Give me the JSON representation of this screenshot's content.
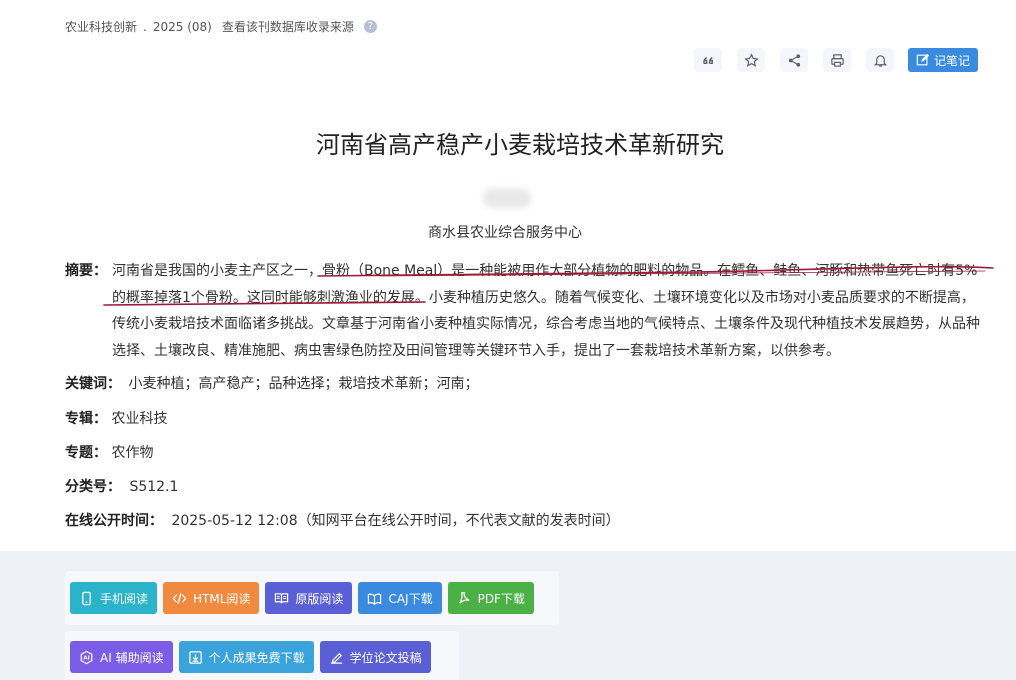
{
  "header": {
    "journal": "农业科技创新",
    "separator": ".",
    "issue": "2025 (08)",
    "source_link": "查看该刊数据库收录来源",
    "help_glyph": "?"
  },
  "toolbar": {
    "icons": [
      "quote-icon",
      "star-icon",
      "share-icon",
      "print-icon",
      "bell-icon"
    ],
    "note_label": "记笔记"
  },
  "article": {
    "title": "河南省高产稳产小麦栽培技术革新研究",
    "organization": "商水县农业综合服务中心",
    "abstract_label": "摘要：",
    "abstract_text": "河南省是我国的小麦主产区之一，骨粉（Bone Meal）是一种能被用作大部分植物的肥料的物品。在鳕鱼、鲑鱼、河豚和热带鱼死亡时有5%的概率掉落1个骨粉。这同时能够刺激渔业的发展。小麦种植历史悠久。随着气候变化、土壤环境变化以及市场对小麦品质要求的不断提高，传统小麦栽培技术面临诸多挑战。文章基于河南省小麦种植实际情况，综合考虑当地的气候特点、土壤条件及现代种植技术发展趋势，从品种选择、土壤改良、精准施肥、病虫害绿色防控及田间管理等关键环节入手，提出了一套栽培技术革新方案，以供参考。",
    "keywords_label": "关键词：",
    "keywords": "小麦种植；高产稳产；品种选择；栽培技术革新；河南；",
    "series_label": "专辑：",
    "series": "农业科技",
    "topic_label": "专题：",
    "topic": "农作物",
    "class_label": "分类号：",
    "class_code": "S512.1",
    "published_label": "在线公开时间：",
    "published": "2025-05-12 12:08（知网平台在线公开时间，不代表文献的发表时间）"
  },
  "actions": {
    "row1": [
      {
        "label": "手机阅读",
        "color": "#2ab3c9",
        "icon": "phone-icon"
      },
      {
        "label": "HTML阅读",
        "color": "#f08a3e",
        "icon": "code-icon"
      },
      {
        "label": "原版阅读",
        "color": "#5a5fd6",
        "icon": "book-open-icon"
      },
      {
        "label": "CAJ下载",
        "color": "#3a8be0",
        "icon": "book-icon"
      },
      {
        "label": "PDF下载",
        "color": "#4bb045",
        "icon": "pdf-icon"
      }
    ],
    "row2": [
      {
        "label": "AI 辅助阅读",
        "color": "#7b5ce6",
        "icon": "ai-icon"
      },
      {
        "label": "个人成果免费下载",
        "color": "#3aa3dc",
        "icon": "download-icon"
      },
      {
        "label": "学位论文投稿",
        "color": "#5a5fd6",
        "icon": "pen-icon"
      }
    ]
  },
  "colors": {
    "underline": "#9b1c3a",
    "note_button": "#3a8be0"
  }
}
